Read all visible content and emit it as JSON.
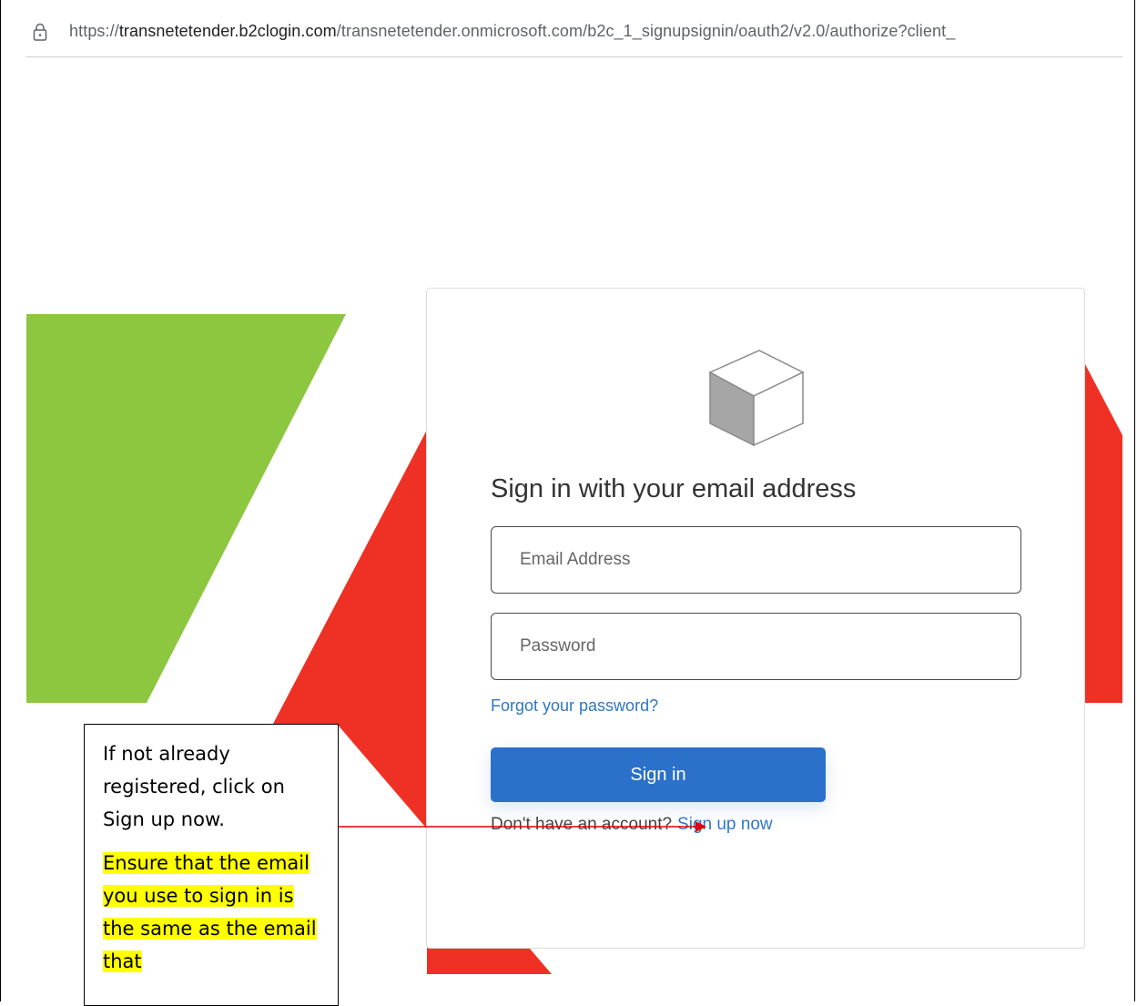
{
  "browser": {
    "url_prefix": "https://",
    "url_host": "transnetetender.b2clogin.com",
    "url_path": "/transnetetender.onmicrosoft.com/b2c_1_signupsignin/oauth2/v2.0/authorize?client_",
    "lock_icon": "lock-icon"
  },
  "colors": {
    "green_shape": "#8dc63f",
    "red_shape": "#ee3124",
    "button": "#2b70c9",
    "link": "#2e77c6",
    "highlight": "#ffff00"
  },
  "login": {
    "logo_icon": "cube-icon",
    "heading": "Sign in with your email address",
    "email_placeholder": "Email Address",
    "password_placeholder": "Password",
    "forgot_link": "Forgot your password?",
    "signin_button": "Sign in",
    "no_account_text": "Don't have an account?",
    "signup_link": "Sign up now"
  },
  "annotation": {
    "instruction": "If not already registered, click on Sign up now.",
    "warning": "Ensure that the email you use to sign in is the same as the email that"
  }
}
